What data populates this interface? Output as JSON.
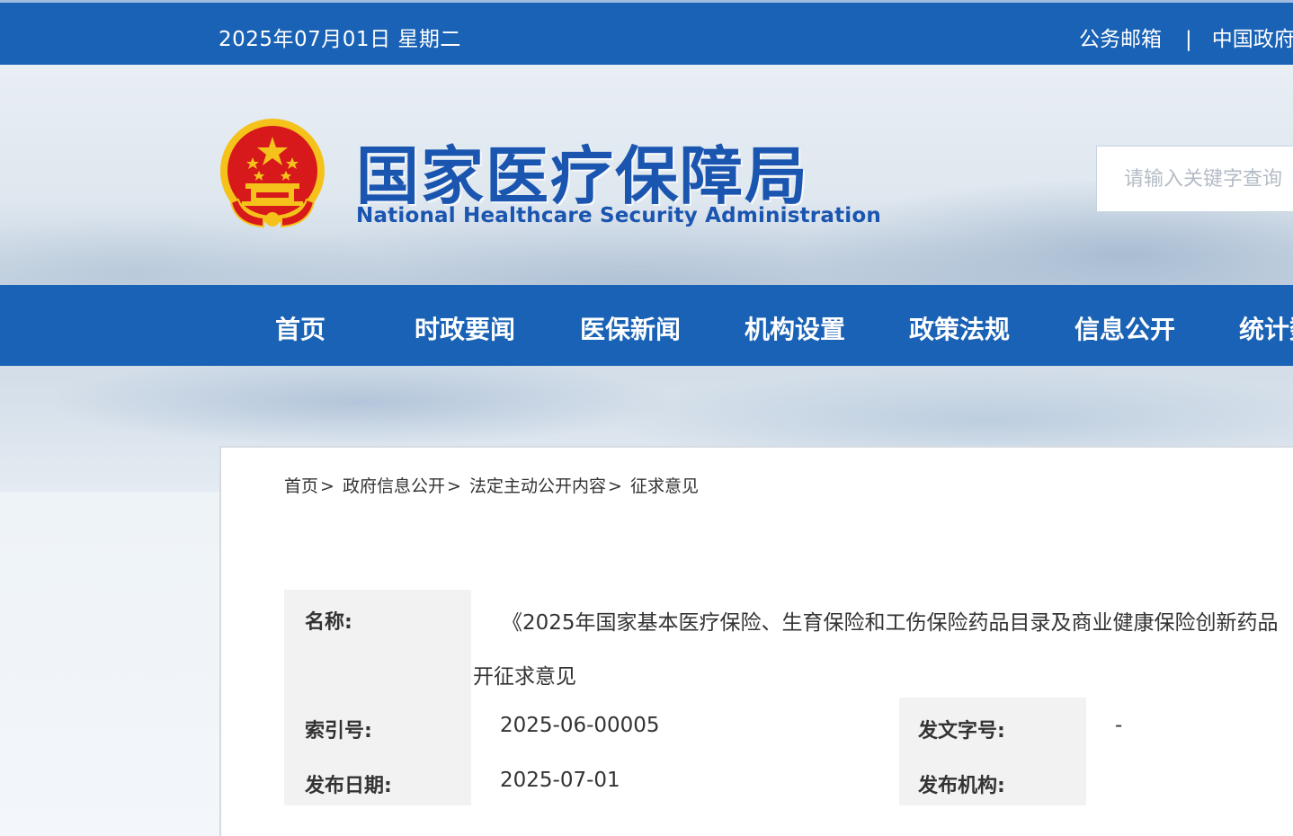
{
  "topbar": {
    "date": "2025年07月01日 星期二",
    "mail": "公务邮箱",
    "separator": "|",
    "gov": "中国政府"
  },
  "header": {
    "title": "国家医疗保障局",
    "subtitle": "National Healthcare Security Administration",
    "search_placeholder": "请输入关键字查询"
  },
  "nav": {
    "items": [
      "首页",
      "时政要闻",
      "医保新闻",
      "机构设置",
      "政策法规",
      "信息公开",
      "统计数"
    ]
  },
  "breadcrumb": {
    "items": [
      "首页",
      "政府信息公开",
      "法定主动公开内容",
      "征求意见"
    ],
    "separator": ">"
  },
  "meta": {
    "name_label": "名称:",
    "name_value_line1": "《2025年国家基本医疗保险、生育保险和工伤保险药品目录及商业健康保险创新药品",
    "name_value_line2": "开征求意见",
    "index_label": "索引号:",
    "index_value": "2025-06-00005",
    "docno_label": "发文字号:",
    "docno_value": "-",
    "date_label": "发布日期:",
    "date_value": "2025-07-01",
    "org_label": "发布机构:",
    "org_value": ""
  },
  "colors": {
    "brand_blue": "#1a62b5",
    "title_blue": "#1a55b0",
    "label_bg": "#f2f2f2",
    "emblem_red": "#d7191b",
    "emblem_gold": "#f5c21b"
  }
}
